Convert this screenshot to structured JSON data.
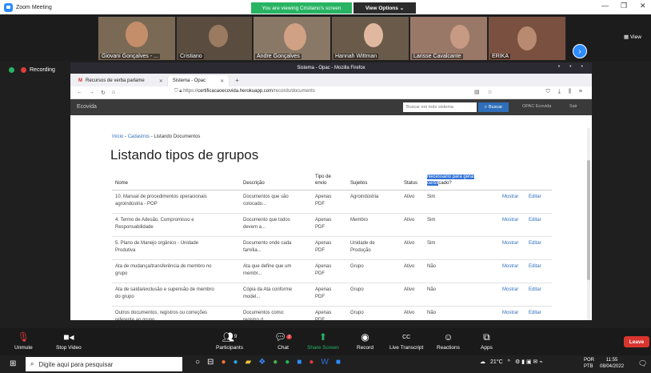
{
  "zoom": {
    "title": "Zoom Meeting",
    "banner": "You are viewing Cristiano's screen",
    "view_options": "View Options ⌄",
    "view_label": "View",
    "recording": "Recording",
    "participants": [
      {
        "name": "Giovani Gonçalves - ...",
        "bg": "#7a6a55"
      },
      {
        "name": "Cristiano",
        "bg": "#5a4d40"
      },
      {
        "name": "Andre Gonçalves",
        "bg": "#8a7866"
      },
      {
        "name": "Hannah Wittman",
        "bg": "#6a5a4a"
      },
      {
        "name": "Larisse Cavalcante",
        "bg": "#9a7868"
      },
      {
        "name": "ERIKA",
        "bg": "#7a5040"
      }
    ],
    "toolbar": {
      "unmute": "Unmute",
      "stop_video": "Stop Video",
      "participants": "Participants",
      "participants_count": "9",
      "chat": "Chat",
      "chat_badge": "2",
      "share_screen": "Share Screen",
      "record": "Record",
      "live_transcript": "Live Transcript",
      "reactions": "Reactions",
      "apps": "Apps",
      "leave": "Leave"
    }
  },
  "browser": {
    "window_title": "Sistema - Opac - Mozilla Firefox",
    "tabs": [
      {
        "label": "Recursos de verba parlame",
        "active": false
      },
      {
        "label": "Sistema - Opac",
        "active": true
      }
    ],
    "url_prefix": "https://",
    "url_host": "certificacaoecovida.herokuapp.com",
    "url_path": "/records/documents"
  },
  "site": {
    "brand": "Ecovida",
    "search_placeholder": "Buscar em todo sistema",
    "search_button": "Buscar",
    "opac_link": "OPAC Ecovida",
    "sair_link": "Sair",
    "breadcrumb": {
      "inicio": "Início",
      "sep": " - ",
      "cadastros": "Cadastros",
      "current": "Listando Documentos"
    },
    "page_title": "Listando tipos de grupos",
    "columns": {
      "nome": "Nome",
      "descricao": "Descrição",
      "tipo1": "Tipo de",
      "tipo2": "envio",
      "sujeitos": "Sujeitos",
      "status": "Status",
      "nec1": "Necessário para gerar",
      "nec2a": "certifi",
      "nec2b": "cado?"
    },
    "rows": [
      {
        "nome1": "10. Manual de procedimentos operacionais",
        "nome2": "agroindústria - POP",
        "desc1": "Documentos que são",
        "desc2": "colocado...",
        "tipo1": "Apenas",
        "tipo2": "PDF",
        "suj1": "Agroindústria",
        "suj2": "",
        "status": "Ativo",
        "nec": "Sim",
        "mostrar": "Mostrar",
        "editar": "Editar"
      },
      {
        "nome1": "4. Termo de Adesão, Compromisso e",
        "nome2": "Responsabilidade",
        "desc1": "Documento que todos",
        "desc2": "devem a...",
        "tipo1": "Apenas",
        "tipo2": "PDF",
        "suj1": "Membro",
        "suj2": "",
        "status": "Ativo",
        "nec": "Sim",
        "mostrar": "Mostrar",
        "editar": "Editar"
      },
      {
        "nome1": "5. Plano de Manejo orgânico - Unidade",
        "nome2": "Produtiva",
        "desc1": "Documento onde cada",
        "desc2": "família...",
        "tipo1": "Apenas",
        "tipo2": "PDF",
        "suj1": "Unidade de",
        "suj2": "Produção",
        "status": "Ativo",
        "nec": "Sim",
        "mostrar": "Mostrar",
        "editar": "Editar"
      },
      {
        "nome1": "Ata de mudança/transferência de membro no",
        "nome2": "grupo",
        "desc1": "Ata que define que um",
        "desc2": "membr...",
        "tipo1": "Apenas",
        "tipo2": "PDF",
        "suj1": "Grupo",
        "suj2": "",
        "status": "Ativo",
        "nec": "Não",
        "mostrar": "Mostrar",
        "editar": "Editar"
      },
      {
        "nome1": "Ata de saída/exclusão e supensão de membro",
        "nome2": "do grupo",
        "desc1": "Cópia da Ata conforme",
        "desc2": "model...",
        "tipo1": "Apenas",
        "tipo2": "PDF",
        "suj1": "Grupo",
        "suj2": "",
        "status": "Ativo",
        "nec": "Não",
        "mostrar": "Mostrar",
        "editar": "Editar"
      },
      {
        "nome1": "Outros documentos, registros ou correções",
        "nome2": "referente ao grupo",
        "desc1": "Documentos como:",
        "desc2": "registro d...",
        "tipo1": "Apenas",
        "tipo2": "PDF",
        "suj1": "Grupo",
        "suj2": "",
        "status": "Ativo",
        "nec": "Não",
        "mostrar": "Mostrar",
        "editar": "Editar"
      }
    ]
  },
  "taskbar": {
    "search_placeholder": "Digite aqui para pesquisar",
    "weather": "21°C",
    "lang1": "POR",
    "lang2": "PTB",
    "time": "11:55",
    "date": "08/04/2022"
  }
}
